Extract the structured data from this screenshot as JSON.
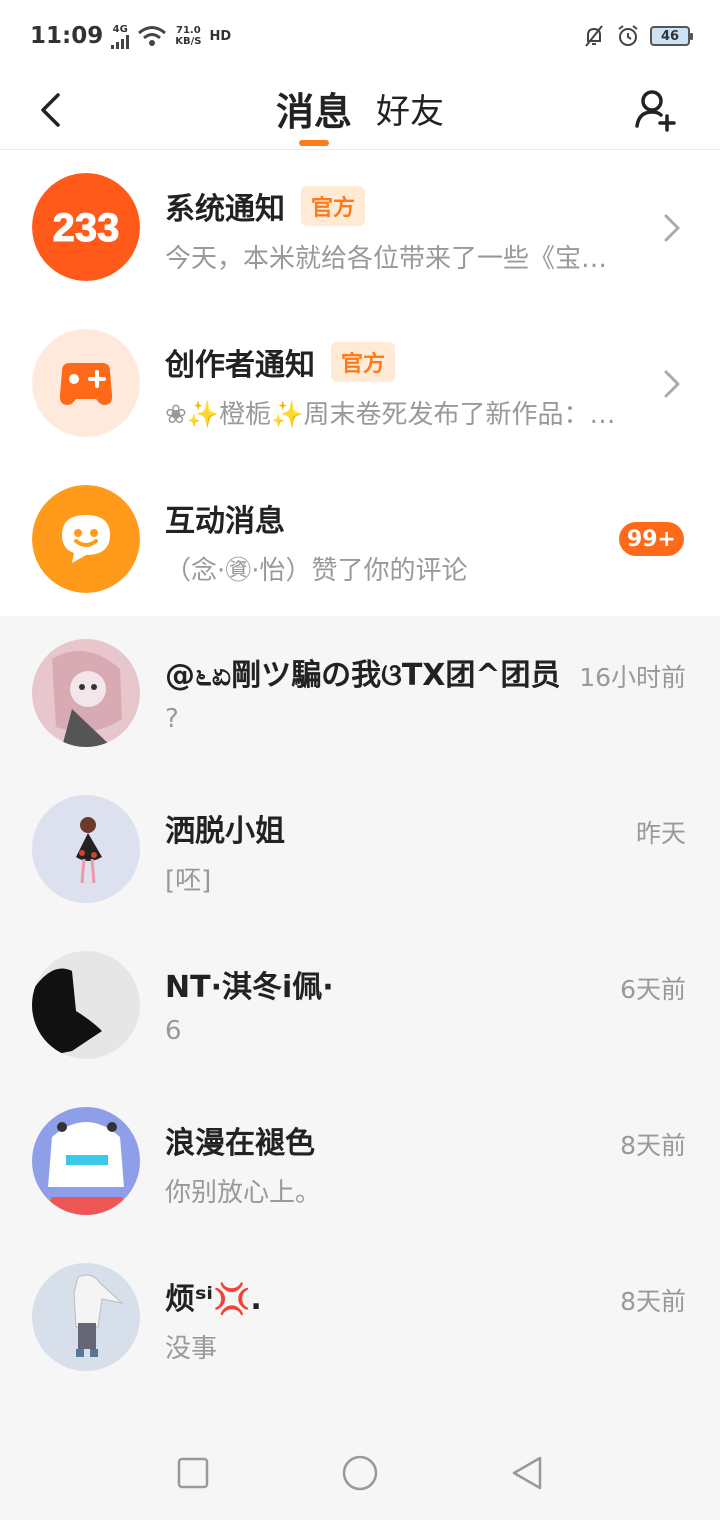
{
  "status_bar": {
    "time": "11:09",
    "network": "4G",
    "speed_value": "71.0",
    "speed_unit": "KB/S",
    "hd": "HD",
    "battery": "46"
  },
  "header": {
    "tabs": [
      "消息",
      "好友"
    ],
    "active_tab": "消息"
  },
  "official": [
    {
      "title": "系统通知",
      "badge": "官方",
      "subtitle": "今天，本米就给各位带来了一些《宝…",
      "avatar_text": "233",
      "avatar_color": "#ff5a1a"
    },
    {
      "title": "创作者通知",
      "badge": "官方",
      "subtitle": "❀✨橙栀✨周末卷死发布了新作品：…",
      "avatar_color": "#ff6a1a"
    },
    {
      "title": "互动消息",
      "subtitle": "（念·㊮·怡）赞了你的评论",
      "count": "99+",
      "avatar_color": "#ff9a1a"
    }
  ],
  "chats": [
    {
      "name": "@೬ಏ剛ツ騙の我ଓTX团^团员",
      "message": "?",
      "time": "16小时前",
      "avatar_bg": "#e7c6cc"
    },
    {
      "name": "洒脱小姐",
      "message": "[呸]",
      "time": "昨天",
      "avatar_bg": "#dde0ef"
    },
    {
      "name": "NT·淇冬i佩·",
      "message": "6",
      "time": "6天前",
      "avatar_bg": "#e6e6e6"
    },
    {
      "name": "浪漫在褪色",
      "message": "你别放心上。",
      "time": "8天前",
      "avatar_bg": "#8f9ee9"
    },
    {
      "name": "烦ˢⁱ💢.",
      "message": "没事",
      "time": "8天前",
      "avatar_bg": "#d7e0ea"
    }
  ],
  "colors": {
    "accent": "#ff7a1a",
    "badge_bg": "#ffead6"
  }
}
